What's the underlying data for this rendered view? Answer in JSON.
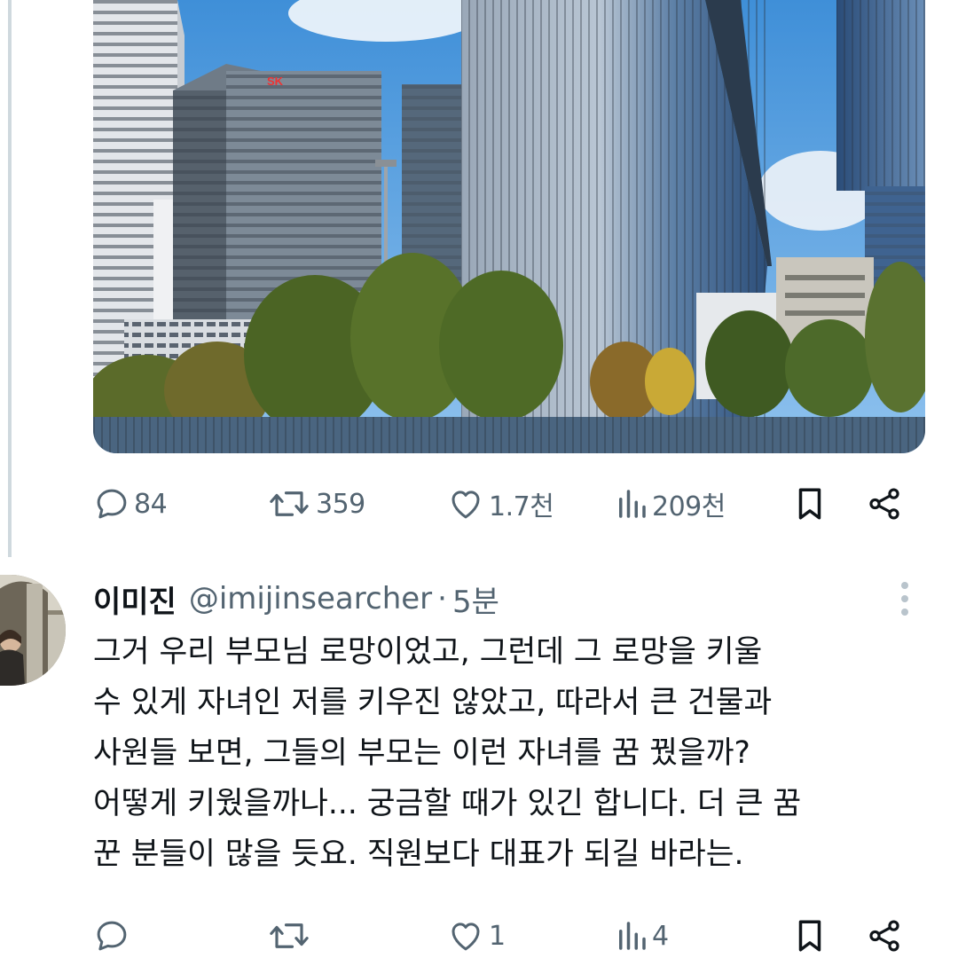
{
  "image": {
    "alt_icon": "city-buildings-photo",
    "sign_text": "SK"
  },
  "main_actions": {
    "reply_count": "84",
    "retweet_count": "359",
    "like_count": "1.7천",
    "view_count": "209천"
  },
  "reply": {
    "name": "이미진",
    "handle": "@imijinsearcher",
    "separator": "·",
    "time": "5분",
    "lines": [
      "그거 우리 부모님 로망이었고, 그런데 그 로망을 키울",
      "수 있게 자녀인 저를 키우진 않았고, 따라서 큰 건물과",
      "사원들 보면, 그들의 부모는 이런 자녀를 꿈 꿨을까?",
      "어떻게 키웠을까나... 궁금할 때가 있긴 합니다. 더 큰 꿈",
      "꾼 분들이 많을 듯요. 직원보다 대표가 되길 바라는."
    ],
    "actions": {
      "reply_count": "",
      "retweet_count": "",
      "like_count": "1",
      "view_count": "4"
    }
  },
  "colors": {
    "muted": "#536471",
    "text": "#0f1419",
    "thread_line": "#cfd9de"
  }
}
